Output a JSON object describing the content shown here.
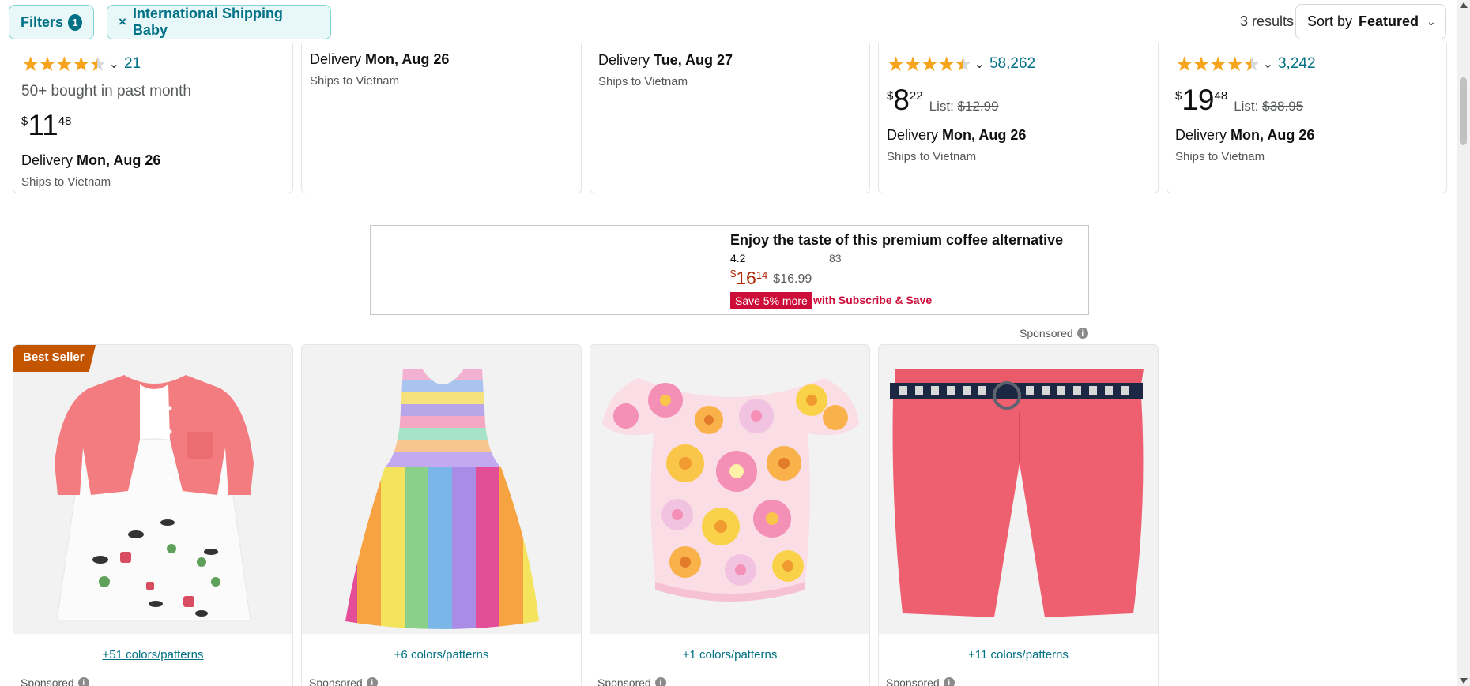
{
  "topbar": {
    "filters_label": "Filters",
    "filters_count": "1",
    "chip_close_glyph": "×",
    "active_filter": "International Shipping Baby",
    "results": "3 results",
    "sort_prefix": "Sort by",
    "sort_value": "Featured"
  },
  "top_cards": [
    {
      "rating": 4.5,
      "rating_count": "21",
      "bought": "50+ bought in past month",
      "price_symbol": "$",
      "price_whole": "11",
      "price_fraction": "48",
      "delivery_label": "Delivery",
      "delivery_date": "Mon, Aug 26",
      "ships": "Ships to Vietnam"
    },
    {
      "delivery_label": "Delivery",
      "delivery_date": "Mon, Aug 26",
      "ships": "Ships to Vietnam"
    },
    {
      "delivery_label": "Delivery",
      "delivery_date": "Tue, Aug 27",
      "ships": "Ships to Vietnam"
    },
    {
      "rating": 4.5,
      "rating_count": "58,262",
      "price_symbol": "$",
      "price_whole": "8",
      "price_fraction": "22",
      "list_label": "List:",
      "list_price": "$12.99",
      "delivery_label": "Delivery",
      "delivery_date": "Mon, Aug 26",
      "ships": "Ships to Vietnam"
    },
    {
      "rating": 4.5,
      "rating_count": "3,242",
      "price_symbol": "$",
      "price_whole": "19",
      "price_fraction": "48",
      "list_label": "List:",
      "list_price": "$38.95",
      "delivery_label": "Delivery",
      "delivery_date": "Mon, Aug 26",
      "ships": "Ships to Vietnam"
    }
  ],
  "banner": {
    "title": "Enjoy the taste of this premium coffee alternative",
    "rating": "4.2",
    "reviews": "83",
    "price_symbol": "$",
    "price_whole": "16",
    "price_fraction": "14",
    "old_price": "$16.99",
    "save_badge": "Save 5% more",
    "subscribe_text": "with Subscribe & Save"
  },
  "sponsored_label": "Sponsored",
  "info_glyph": "i",
  "products": [
    {
      "badge": "Best Seller",
      "colors": "+51 colors/patterns",
      "sponsored": "Sponsored",
      "image": "cardigan-dress-set"
    },
    {
      "colors": "+6 colors/patterns",
      "sponsored": "Sponsored",
      "image": "rainbow-stripe-dress"
    },
    {
      "colors": "+1 colors/patterns",
      "sponsored": "Sponsored",
      "image": "floral-top"
    },
    {
      "colors": "+11 colors/patterns",
      "sponsored": "Sponsored",
      "image": "pink-shorts-with-belt"
    }
  ],
  "icons": {
    "star": "★",
    "chevron_down": "⌄"
  },
  "colors": {
    "link": "#007185",
    "price_red": "#b12704",
    "save_red": "#cc0c39",
    "best_seller": "#c45500",
    "star": "#f7a41d"
  }
}
